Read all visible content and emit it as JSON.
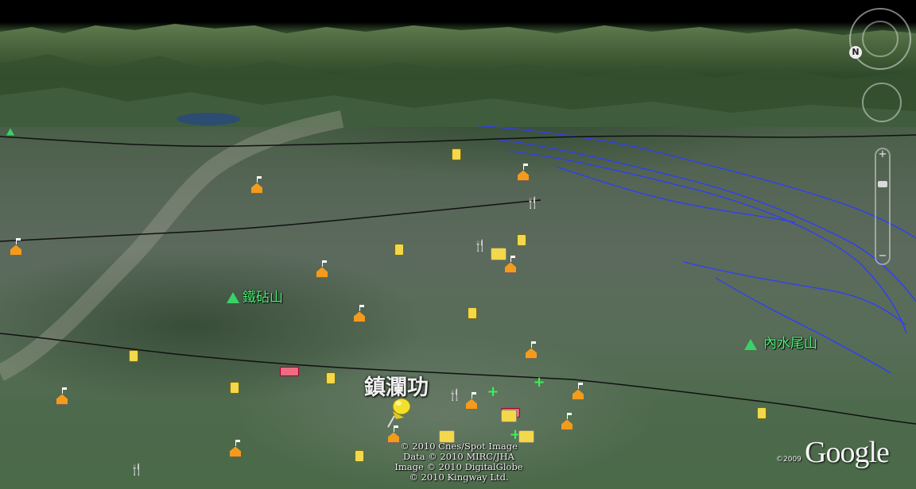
{
  "map": {
    "place_labels": {
      "town": "鎮瀾功",
      "peak_west": "鐵砧山",
      "peak_east": "內水尾山"
    },
    "copyright_lines": [
      "© 2010 Cnes/Spot Image",
      "Data © 2010 MIRC/JHA",
      "Image © 2010 DigitalGlobe",
      "© 2010 Kingway Ltd."
    ],
    "logo": {
      "text": "Google",
      "year": "©2009"
    },
    "navigation": {
      "north_label": "N",
      "zoom_in": "+",
      "zoom_out": "−"
    },
    "colors": {
      "river": "#2f3cff",
      "boundary": "#111111",
      "peak_label": "#4ef07a",
      "home_marker": "#f49b1c",
      "fuel_marker": "#f2d84a",
      "lodging_marker": "#f06a82",
      "hospital_marker": "#3cf05a"
    },
    "icons": [
      "home-marker-icon",
      "fuel-station-icon",
      "mountain-peak-icon",
      "lodging-icon",
      "restaurant-icon",
      "hospital-icon",
      "shopping-icon",
      "placemark-pushpin-icon"
    ]
  }
}
